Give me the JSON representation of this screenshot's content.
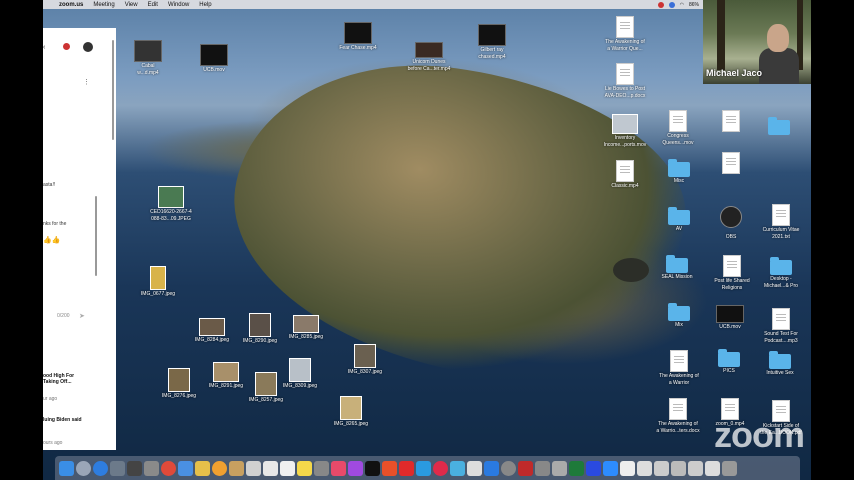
{
  "menubar": {
    "app": "zoom.us",
    "items": [
      "Meeting",
      "View",
      "Edit",
      "Window",
      "Help"
    ],
    "battery": "86%"
  },
  "chat": {
    "lines": [
      "asta!!",
      "nks for the",
      "0/200"
    ],
    "news1": "ood High For",
    "news2": "Taking Off...",
    "news3": "ur ago",
    "news4": "luing Biden said",
    "news5": "ours ago"
  },
  "webcam": {
    "name": "Michael Jaco"
  },
  "desktop_icons": [
    {
      "key": "cabal",
      "label": "Cabal",
      "label2": "w...d.mp4",
      "kind": "video"
    },
    {
      "key": "ucb",
      "label": "UCB.mov",
      "kind": "video"
    },
    {
      "key": "fear",
      "label": "Fear Chase.mp4",
      "kind": "video"
    },
    {
      "key": "dunes",
      "label": "Unicorn Dunes",
      "label2": "before Ca...ter.mp4",
      "kind": "video"
    },
    {
      "key": "gilbert",
      "label": "Gilbert ray",
      "label2": "chased.mp4",
      "kind": "video"
    },
    {
      "key": "awakening1",
      "label": "The Awakening of",
      "label2": "a Warrior Que...",
      "kind": "doc"
    },
    {
      "key": "img0677",
      "label": "IMG_0677.jpeg",
      "kind": "photo"
    },
    {
      "key": "ced",
      "label": "CED16620-2667-4",
      "label2": "088-83...09.JPEG",
      "kind": "photo"
    },
    {
      "key": "img8284",
      "label": "IMG_8284.jpeg",
      "kind": "photo"
    },
    {
      "key": "img8290",
      "label": "IMG_8290.jpeg",
      "kind": "photo"
    },
    {
      "key": "img8285",
      "label": "IMG_8285.jpeg",
      "kind": "photo"
    },
    {
      "key": "img8307",
      "label": "IMG_8307.jpeg",
      "kind": "photo"
    },
    {
      "key": "img8276",
      "label": "IMG_8276.jpeg",
      "kind": "photo"
    },
    {
      "key": "img8291",
      "label": "IMG_8291.jpeg",
      "kind": "photo"
    },
    {
      "key": "img8257",
      "label": "IMG_8257.jpeg",
      "kind": "photo"
    },
    {
      "key": "img8309",
      "label": "IMG_8309.jpeg",
      "kind": "photo"
    },
    {
      "key": "img8265",
      "label": "IMG_8265.jpeg",
      "kind": "photo"
    },
    {
      "key": "doc2",
      "label": "Lie Bowes to Post",
      "label2": "AVA-DEO...p.docx",
      "kind": "doc"
    },
    {
      "key": "inventory",
      "label": "Inventory",
      "label2": "Income...ports.mov",
      "kind": "photo"
    },
    {
      "key": "congress",
      "label": "Congress",
      "label2": "Queens...mov",
      "kind": "doc"
    },
    {
      "key": "classic",
      "label": "Classic.mp4",
      "kind": "doc"
    },
    {
      "key": "fold1",
      "label": "Misc",
      "kind": "folder"
    },
    {
      "key": "fold_av",
      "label": "AV",
      "kind": "folder"
    },
    {
      "key": "obs",
      "label": "OBS",
      "kind": "app"
    },
    {
      "key": "seal",
      "label": "SEAL Mission",
      "kind": "folder"
    },
    {
      "key": "post",
      "label": "Post life Shared",
      "label2": "Religions",
      "kind": "doc"
    },
    {
      "key": "fold_mix",
      "label": "Mix",
      "kind": "folder"
    },
    {
      "key": "ucbmov",
      "label": "UCB.mov",
      "kind": "video"
    },
    {
      "key": "awakening2",
      "label": "The Awakening of",
      "label2": "a Warrior",
      "kind": "doc"
    },
    {
      "key": "pics",
      "label": "PICS",
      "kind": "folder"
    },
    {
      "key": "awakening3",
      "label": "The Awakening of",
      "label2": "a Warrio...ters.docx",
      "kind": "doc"
    },
    {
      "key": "zoom0",
      "label": "zoom_0.mp4",
      "kind": "doc"
    },
    {
      "key": "curriculum",
      "label": "Curriculum Vitae",
      "label2": "2021.txt",
      "kind": "doc"
    },
    {
      "key": "desktop_michael",
      "label": "Desktop -",
      "label2": "Michael...& Pro",
      "kind": "folder"
    },
    {
      "key": "sound",
      "label": "Sound Test For",
      "label2": "Podcast....mp3",
      "kind": "doc"
    },
    {
      "key": "intuitive",
      "label": "Intuitive Sex",
      "kind": "folder"
    },
    {
      "key": "kickstart",
      "label": "Kickstart Side of",
      "label2": "the Ea...BOOK.pdf",
      "kind": "doc"
    }
  ],
  "watermark": "zoom",
  "colors": {
    "folder": "#5ab4ea",
    "chat_bg": "#ffffff",
    "menubar": "#e1e1e4"
  }
}
